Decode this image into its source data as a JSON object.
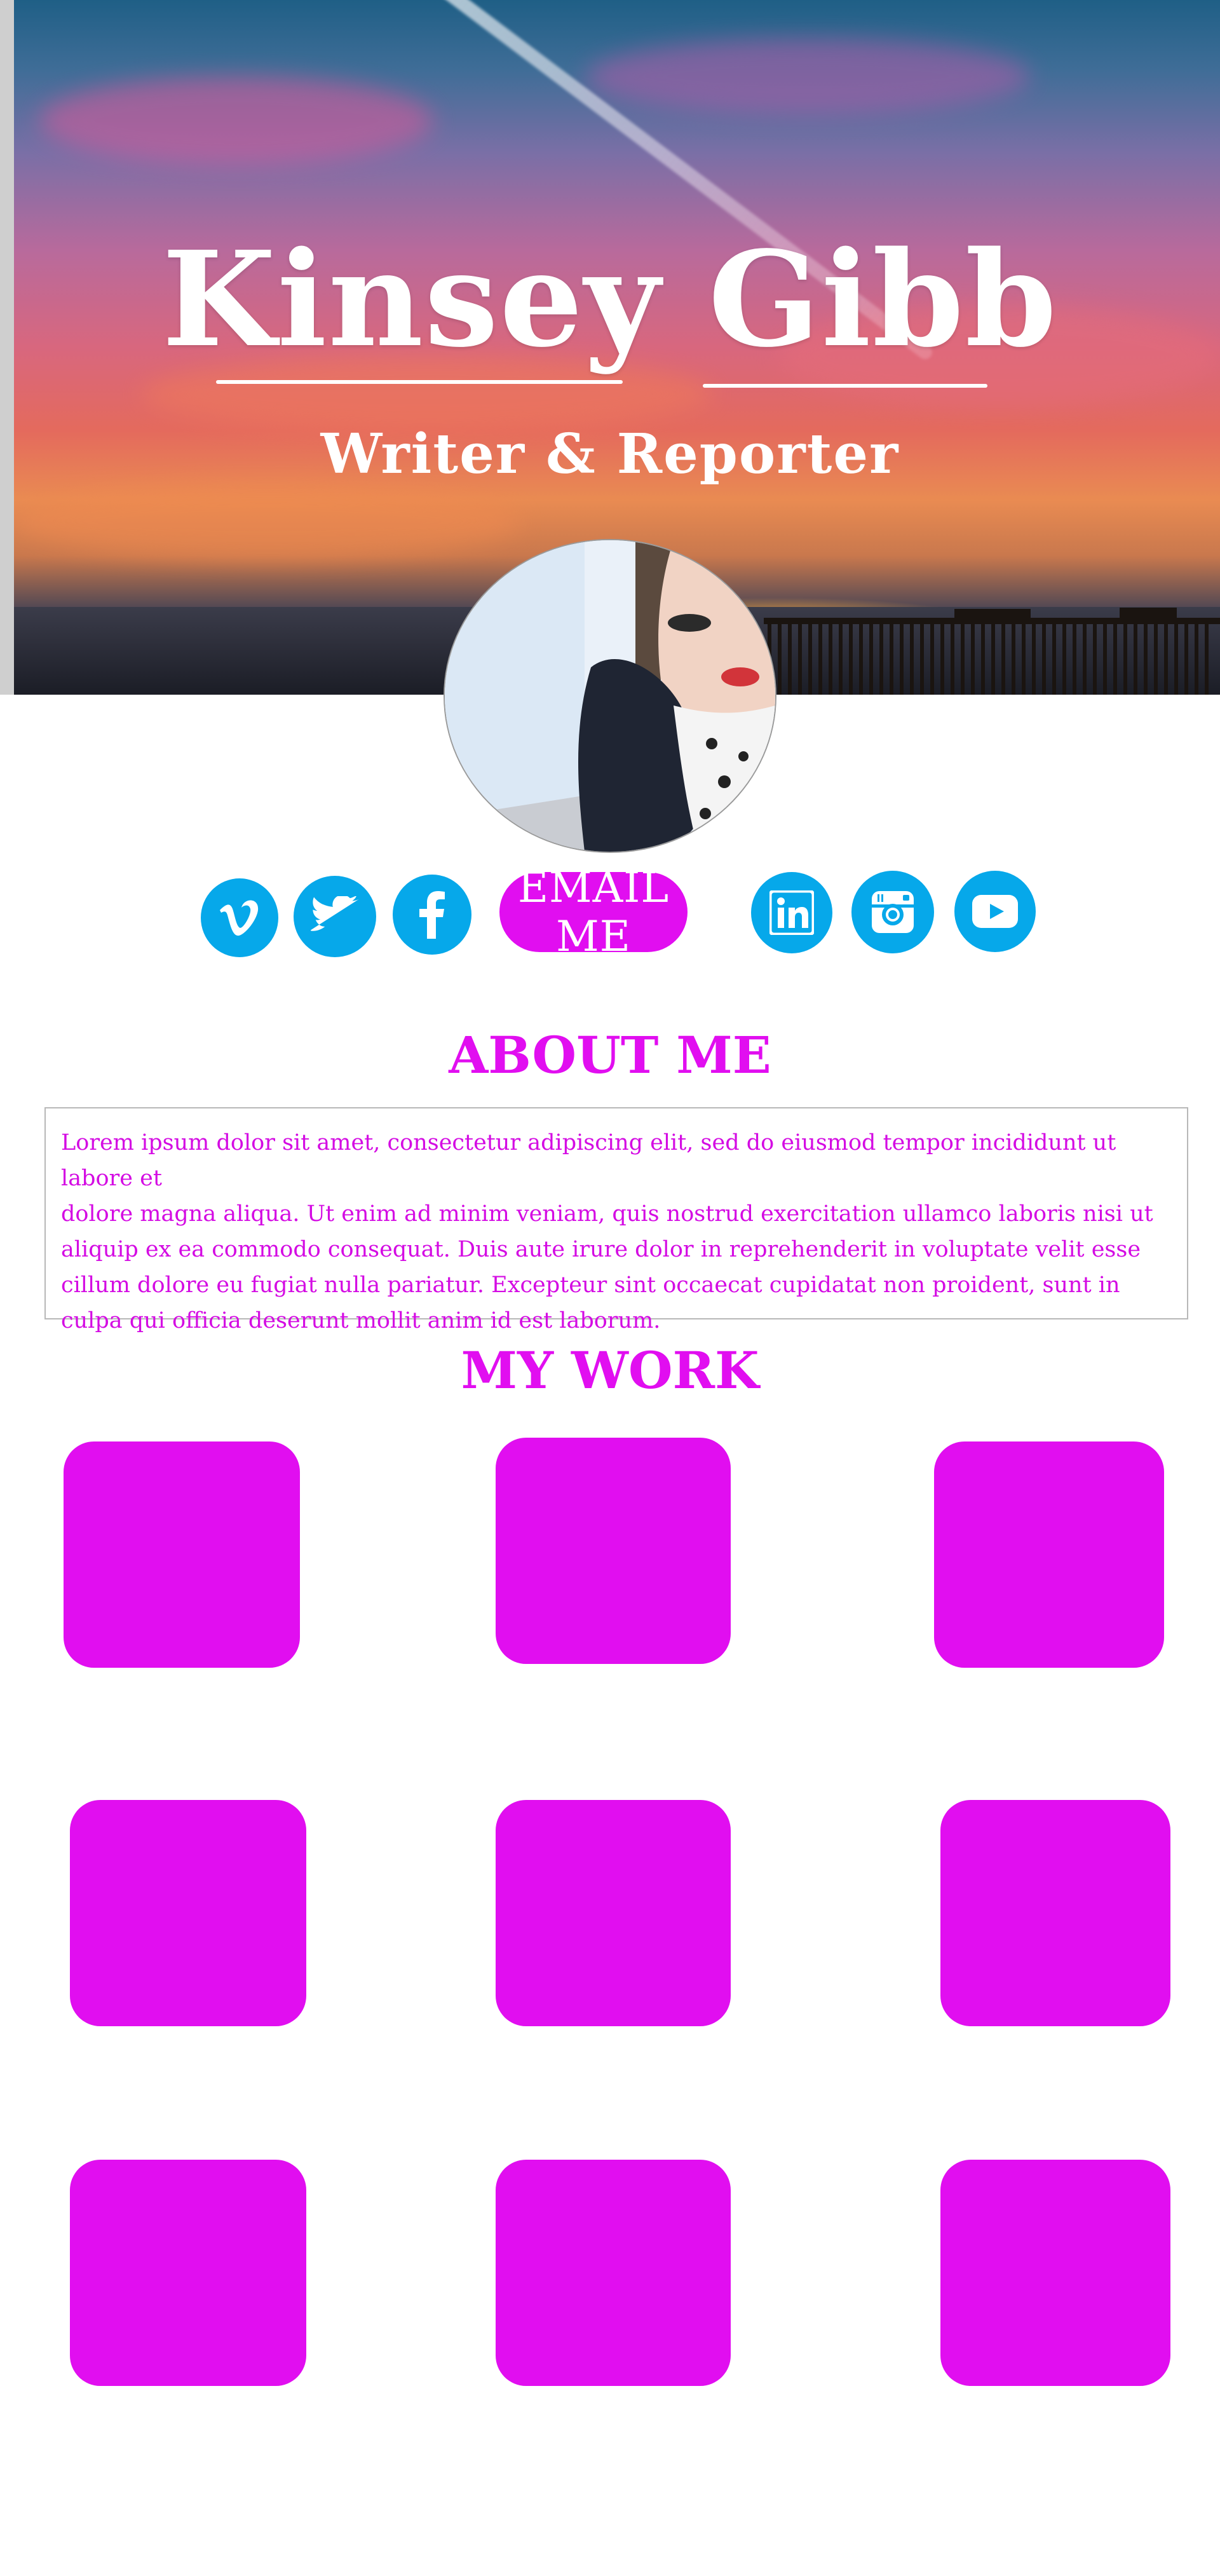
{
  "header": {
    "name": "Kinsey Gibb",
    "tagline": "Writer & Reporter"
  },
  "social_links": [
    {
      "icon": "vimeo-icon"
    },
    {
      "icon": "twitter-icon"
    },
    {
      "icon": "facebook-icon"
    },
    {
      "icon": "linkedin-icon"
    },
    {
      "icon": "instagram-icon"
    },
    {
      "icon": "youtube-icon"
    }
  ],
  "email_button": {
    "label": "EMAIL ME"
  },
  "about": {
    "heading": "ABOUT ME",
    "body": "Lorem ipsum dolor sit amet, consectetur adipiscing elit, sed do eiusmod tempor incididunt ut labore et\n dolore magna aliqua. Ut enim ad minim veniam, quis nostrud exercitation ullamco laboris nisi ut\naliquip ex ea commodo consequat. Duis aute irure dolor in reprehenderit in voluptate velit esse\ncillum dolore eu fugiat nulla pariatur. Excepteur sint occaecat cupidatat non proident, sunt in\nculpa qui officia deserunt mollit anim id est laborum."
  },
  "work": {
    "heading": "MY WORK",
    "tile_count": 9
  },
  "colors": {
    "accent": "#e10ef0",
    "social": "#06a8ea",
    "text_light": "#ffffff"
  }
}
